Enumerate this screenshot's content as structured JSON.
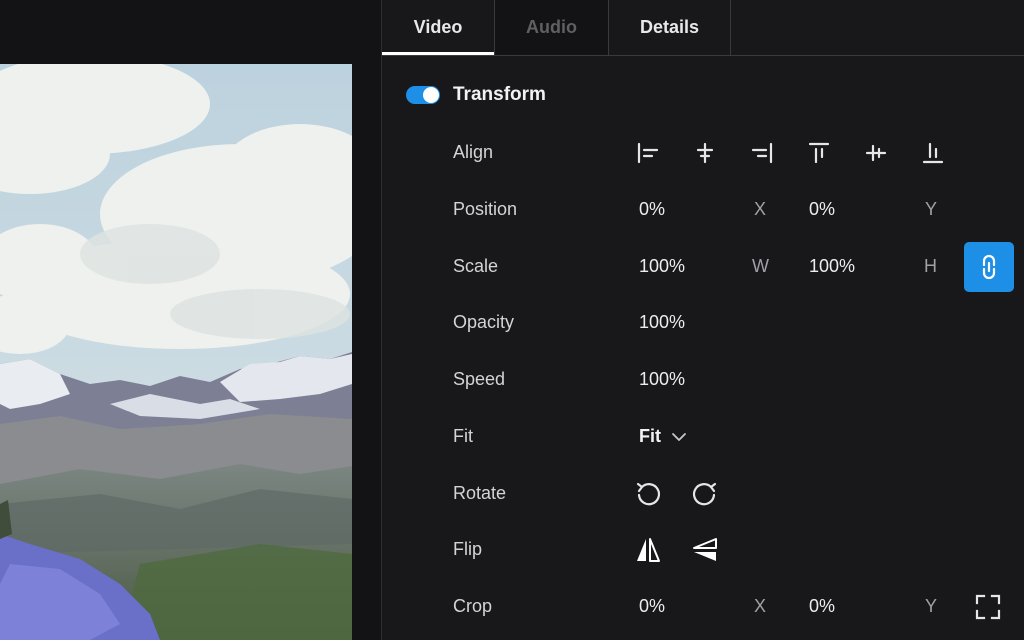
{
  "tabs": [
    {
      "label": "Video",
      "state": "active"
    },
    {
      "label": "Audio",
      "state": "disabled"
    },
    {
      "label": "Details",
      "state": "normal"
    }
  ],
  "section": {
    "title": "Transform",
    "enabled": true
  },
  "align": {
    "label": "Align",
    "icons": [
      "align-left-icon",
      "align-center-horizontal-icon",
      "align-right-icon",
      "align-top-icon",
      "align-middle-vertical-icon",
      "align-bottom-icon"
    ]
  },
  "position": {
    "label": "Position",
    "x": "0%",
    "x_axis": "X",
    "y": "0%",
    "y_axis": "Y"
  },
  "scale": {
    "label": "Scale",
    "w": "100%",
    "w_axis": "W",
    "h": "100%",
    "h_axis": "H",
    "link_icon": "link-icon"
  },
  "opacity": {
    "label": "Opacity",
    "value": "100%"
  },
  "speed": {
    "label": "Speed",
    "value": "100%"
  },
  "fit": {
    "label": "Fit",
    "value": "Fit"
  },
  "rotate": {
    "label": "Rotate",
    "icons": [
      "rotate-left-icon",
      "rotate-right-icon"
    ]
  },
  "flip": {
    "label": "Flip",
    "icons": [
      "flip-horizontal-icon",
      "flip-vertical-icon"
    ]
  },
  "crop": {
    "label": "Crop",
    "x": "0%",
    "x_axis": "X",
    "y": "0%",
    "y_axis": "Y",
    "icon": "crop-frame-icon"
  },
  "colors": {
    "accent": "#1e8fe6",
    "panel_bg": "#18181b",
    "page_bg": "#141416"
  }
}
